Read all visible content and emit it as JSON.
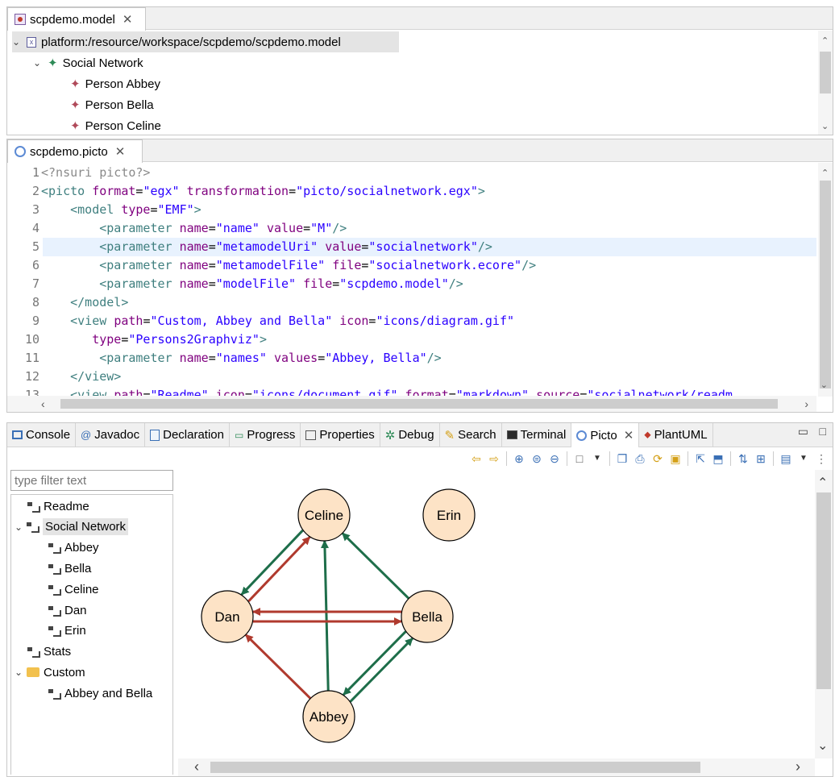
{
  "model_editor": {
    "tab_label": "scpdemo.model",
    "root_uri": "platform:/resource/workspace/scpdemo/scpdemo.model",
    "items": [
      {
        "label": "Social Network"
      },
      {
        "label": "Person Abbey"
      },
      {
        "label": "Person Bella"
      },
      {
        "label": "Person Celine"
      }
    ]
  },
  "picto_editor": {
    "tab_label": "scpdemo.picto",
    "lines": [
      {
        "n": "1",
        "segs": [
          {
            "t": "<?nsuri picto?>",
            "c": "pi"
          }
        ]
      },
      {
        "n": "2",
        "segs": [
          {
            "t": "<picto ",
            "c": "tag"
          },
          {
            "t": "format",
            "c": "att"
          },
          {
            "t": "=",
            "c": ""
          },
          {
            "t": "\"egx\"",
            "c": "val"
          },
          {
            "t": " transformation",
            "c": "att"
          },
          {
            "t": "=",
            "c": ""
          },
          {
            "t": "\"picto/socialnetwork.egx\"",
            "c": "val"
          },
          {
            "t": ">",
            "c": "tag"
          }
        ]
      },
      {
        "n": "3",
        "segs": [
          {
            "t": "    <model ",
            "c": "tag"
          },
          {
            "t": "type",
            "c": "att"
          },
          {
            "t": "=",
            "c": ""
          },
          {
            "t": "\"EMF\"",
            "c": "val"
          },
          {
            "t": ">",
            "c": "tag"
          }
        ]
      },
      {
        "n": "4",
        "segs": [
          {
            "t": "        <parameter ",
            "c": "tag"
          },
          {
            "t": "name",
            "c": "att"
          },
          {
            "t": "=",
            "c": ""
          },
          {
            "t": "\"name\"",
            "c": "val"
          },
          {
            "t": " value",
            "c": "att"
          },
          {
            "t": "=",
            "c": ""
          },
          {
            "t": "\"M\"",
            "c": "val"
          },
          {
            "t": "/>",
            "c": "tag"
          }
        ]
      },
      {
        "n": "5",
        "segs": [
          {
            "t": "        <parameter ",
            "c": "tag"
          },
          {
            "t": "name",
            "c": "att"
          },
          {
            "t": "=",
            "c": ""
          },
          {
            "t": "\"metamodelUri\"",
            "c": "val"
          },
          {
            "t": " value",
            "c": "att"
          },
          {
            "t": "=",
            "c": ""
          },
          {
            "t": "\"socialnetwork\"",
            "c": "val"
          },
          {
            "t": "/>",
            "c": "tag"
          }
        ]
      },
      {
        "n": "6",
        "segs": [
          {
            "t": "        <parameter ",
            "c": "tag"
          },
          {
            "t": "name",
            "c": "att"
          },
          {
            "t": "=",
            "c": ""
          },
          {
            "t": "\"metamodelFile\"",
            "c": "val"
          },
          {
            "t": " file",
            "c": "att"
          },
          {
            "t": "=",
            "c": ""
          },
          {
            "t": "\"socialnetwork.ecore\"",
            "c": "val"
          },
          {
            "t": "/>",
            "c": "tag"
          }
        ]
      },
      {
        "n": "7",
        "segs": [
          {
            "t": "        <parameter ",
            "c": "tag"
          },
          {
            "t": "name",
            "c": "att"
          },
          {
            "t": "=",
            "c": ""
          },
          {
            "t": "\"modelFile\"",
            "c": "val"
          },
          {
            "t": " file",
            "c": "att"
          },
          {
            "t": "=",
            "c": ""
          },
          {
            "t": "\"scpdemo.model\"",
            "c": "val"
          },
          {
            "t": "/>",
            "c": "tag"
          }
        ]
      },
      {
        "n": "8",
        "segs": [
          {
            "t": "    </model>",
            "c": "tag"
          }
        ]
      },
      {
        "n": "9",
        "segs": [
          {
            "t": "    <view ",
            "c": "tag"
          },
          {
            "t": "path",
            "c": "att"
          },
          {
            "t": "=",
            "c": ""
          },
          {
            "t": "\"Custom, Abbey and Bella\"",
            "c": "val"
          },
          {
            "t": " icon",
            "c": "att"
          },
          {
            "t": "=",
            "c": ""
          },
          {
            "t": "\"icons/diagram.gif\"",
            "c": "val"
          }
        ]
      },
      {
        "n": "10",
        "segs": [
          {
            "t": "       type",
            "c": "att"
          },
          {
            "t": "=",
            "c": ""
          },
          {
            "t": "\"Persons2Graphviz\"",
            "c": "val"
          },
          {
            "t": ">",
            "c": "tag"
          }
        ]
      },
      {
        "n": "11",
        "segs": [
          {
            "t": "        <parameter ",
            "c": "tag"
          },
          {
            "t": "name",
            "c": "att"
          },
          {
            "t": "=",
            "c": ""
          },
          {
            "t": "\"names\"",
            "c": "val"
          },
          {
            "t": " values",
            "c": "att"
          },
          {
            "t": "=",
            "c": ""
          },
          {
            "t": "\"Abbey, Bella\"",
            "c": "val"
          },
          {
            "t": "/>",
            "c": "tag"
          }
        ]
      },
      {
        "n": "12",
        "segs": [
          {
            "t": "    </view>",
            "c": "tag"
          }
        ]
      },
      {
        "n": "13",
        "segs": [
          {
            "t": "    <view ",
            "c": "tag"
          },
          {
            "t": "path",
            "c": "att"
          },
          {
            "t": "=",
            "c": ""
          },
          {
            "t": "\"Readme\"",
            "c": "val"
          },
          {
            "t": " icon",
            "c": "att"
          },
          {
            "t": "=",
            "c": ""
          },
          {
            "t": "\"icons/document.gif\"",
            "c": "val"
          },
          {
            "t": " format",
            "c": "att"
          },
          {
            "t": "=",
            "c": ""
          },
          {
            "t": "\"markdown\"",
            "c": "val"
          },
          {
            "t": " source",
            "c": "att"
          },
          {
            "t": "=",
            "c": ""
          },
          {
            "t": "\"socialnetwork/readm",
            "c": "val"
          }
        ]
      }
    ]
  },
  "views": {
    "tabs": [
      "Console",
      "Javadoc",
      "Declaration",
      "Progress",
      "Properties",
      "Debug",
      "Search",
      "Terminal",
      "Picto",
      "PlantUML"
    ],
    "active_tab": "Picto"
  },
  "picto_view": {
    "filter_placeholder": "type filter text",
    "tree": [
      {
        "label": "Readme",
        "level": 0,
        "expander": ""
      },
      {
        "label": "Social Network",
        "level": 0,
        "expander": "v",
        "selected": true
      },
      {
        "label": "Abbey",
        "level": 1,
        "expander": ""
      },
      {
        "label": "Bella",
        "level": 1,
        "expander": ""
      },
      {
        "label": "Celine",
        "level": 1,
        "expander": ""
      },
      {
        "label": "Dan",
        "level": 1,
        "expander": ""
      },
      {
        "label": "Erin",
        "level": 1,
        "expander": ""
      },
      {
        "label": "Stats",
        "level": 0,
        "expander": ""
      },
      {
        "label": "Custom",
        "level": 0,
        "expander": "v",
        "folder": true
      },
      {
        "label": "Abbey and Bella",
        "level": 1,
        "expander": ""
      }
    ]
  },
  "graph": {
    "nodes": [
      "Celine",
      "Erin",
      "Dan",
      "Bella",
      "Abbey"
    ],
    "edges": [
      {
        "from": "Dan",
        "to": "Celine",
        "color": "#b03a2e"
      },
      {
        "from": "Celine",
        "to": "Dan",
        "color": "#1e6e4a"
      },
      {
        "from": "Abbey",
        "to": "Celine",
        "color": "#1e6e4a"
      },
      {
        "from": "Bella",
        "to": "Celine",
        "color": "#1e6e4a"
      },
      {
        "from": "Dan",
        "to": "Bella",
        "color": "#b03a2e"
      },
      {
        "from": "Bella",
        "to": "Dan",
        "color": "#b03a2e"
      },
      {
        "from": "Abbey",
        "to": "Dan",
        "color": "#b03a2e"
      },
      {
        "from": "Abbey",
        "to": "Bella",
        "color": "#1e6e4a"
      },
      {
        "from": "Bella",
        "to": "Abbey",
        "color": "#1e6e4a"
      }
    ],
    "node_fill": "#fde3c6"
  }
}
